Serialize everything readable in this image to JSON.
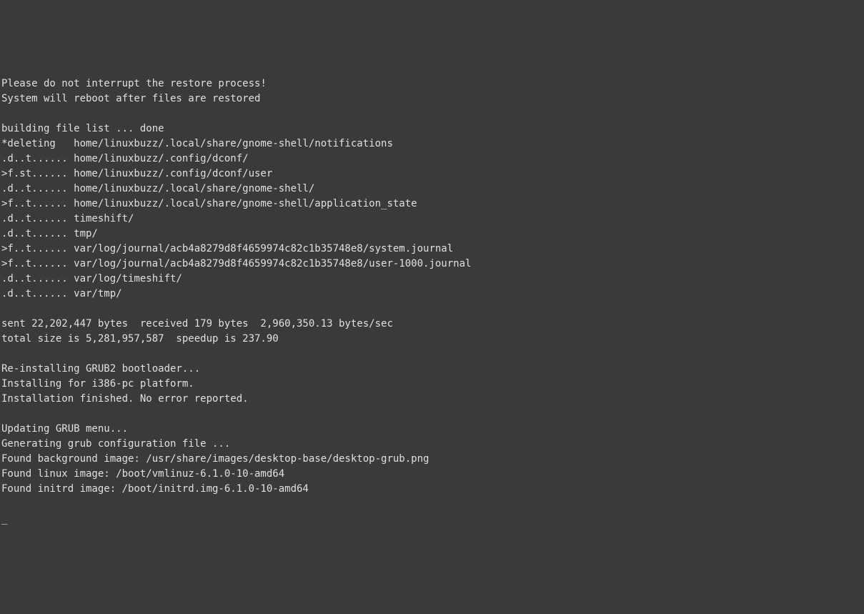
{
  "terminal": {
    "lines": [
      "",
      "Please do not interrupt the restore process!",
      "System will reboot after files are restored",
      "",
      "building file list ... done",
      "*deleting   home/linuxbuzz/.local/share/gnome-shell/notifications",
      ".d..t...... home/linuxbuzz/.config/dconf/",
      ">f.st...... home/linuxbuzz/.config/dconf/user",
      ".d..t...... home/linuxbuzz/.local/share/gnome-shell/",
      ">f..t...... home/linuxbuzz/.local/share/gnome-shell/application_state",
      ".d..t...... timeshift/",
      ".d..t...... tmp/",
      ">f..t...... var/log/journal/acb4a8279d8f4659974c82c1b35748e8/system.journal",
      ">f..t...... var/log/journal/acb4a8279d8f4659974c82c1b35748e8/user-1000.journal",
      ".d..t...... var/log/timeshift/",
      ".d..t...... var/tmp/",
      "",
      "sent 22,202,447 bytes  received 179 bytes  2,960,350.13 bytes/sec",
      "total size is 5,281,957,587  speedup is 237.90",
      "",
      "Re-installing GRUB2 bootloader...",
      "Installing for i386-pc platform.",
      "Installation finished. No error reported.",
      "",
      "Updating GRUB menu...",
      "Generating grub configuration file ...",
      "Found background image: /usr/share/images/desktop-base/desktop-grub.png",
      "Found linux image: /boot/vmlinuz-6.1.0-10-amd64",
      "Found initrd image: /boot/initrd.img-6.1.0-10-amd64",
      ""
    ],
    "cursor": "_"
  }
}
